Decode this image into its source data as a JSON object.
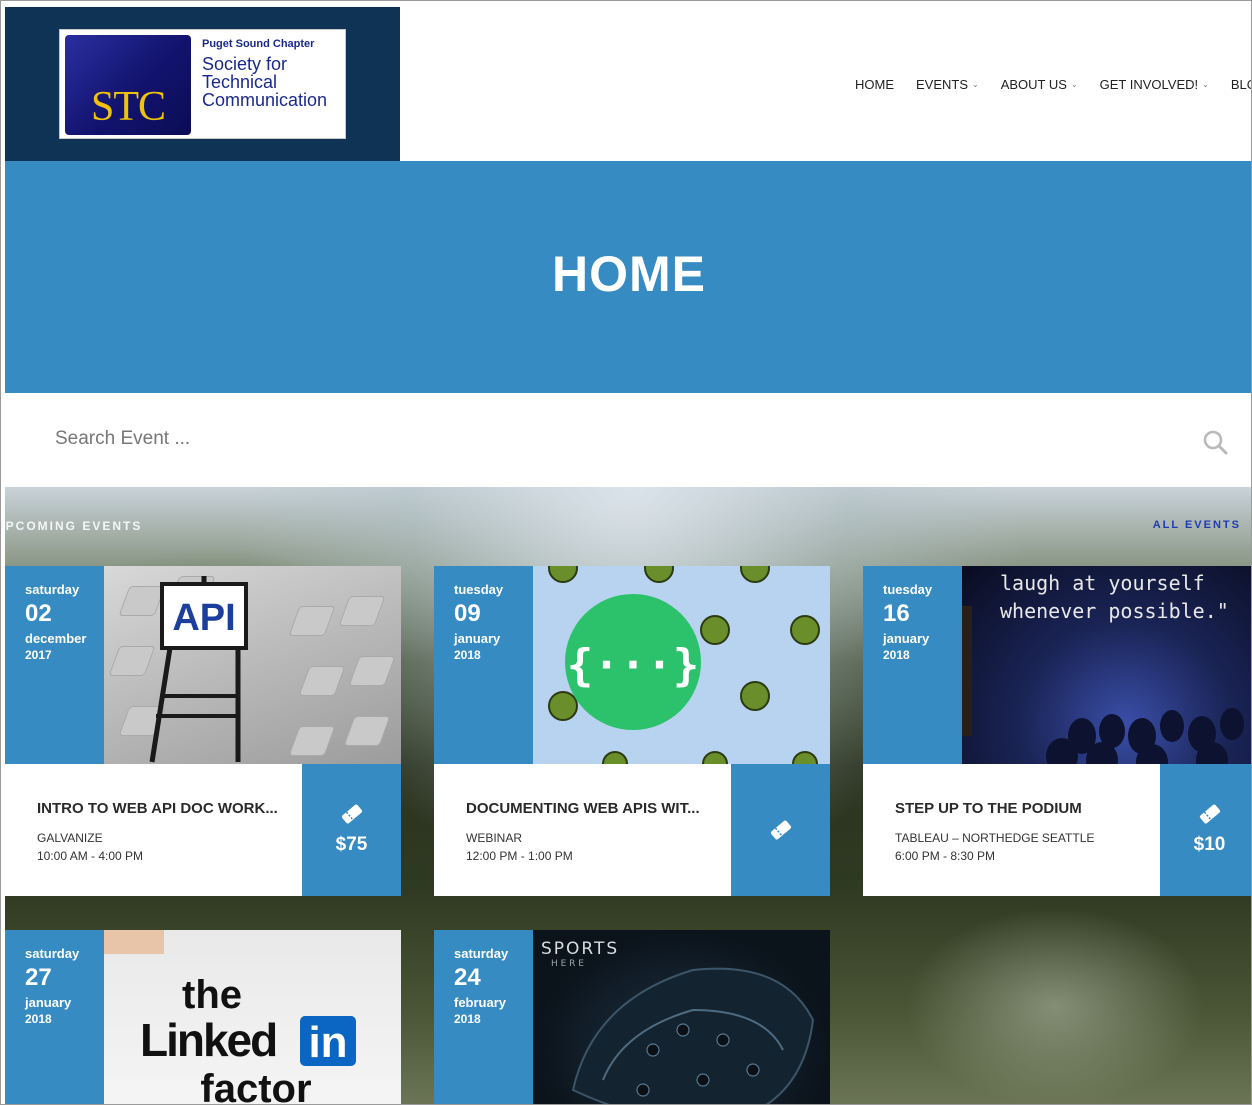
{
  "logo": {
    "chapter": "Puget Sound Chapter",
    "name": "Society for Technical Communication",
    "mark": "STC"
  },
  "nav": {
    "items": [
      {
        "label": "HOME",
        "has_caret": false
      },
      {
        "label": "EVENTS",
        "has_caret": true
      },
      {
        "label": "ABOUT US",
        "has_caret": true
      },
      {
        "label": "GET INVOLVED!",
        "has_caret": true
      },
      {
        "label": "BLO",
        "has_caret": false
      }
    ],
    "caret": "⌄"
  },
  "hero": {
    "title": "HOME"
  },
  "search": {
    "placeholder": "Search Event ..."
  },
  "section": {
    "label": "UPCOMING EVENTS",
    "all_events": "ALL EVENTS"
  },
  "colors": {
    "accent": "#368bc2",
    "header_dark": "#0e3354",
    "link": "#1e3bb4"
  },
  "events": [
    {
      "weekday": "saturday",
      "day": "02",
      "month": "december",
      "year": "2017",
      "title": "INTRO TO WEB API DOC WORK...",
      "venue": "GALVANIZE",
      "time": "10:00 AM - 4:00 PM",
      "price": "$75",
      "image": {
        "caption": "API"
      }
    },
    {
      "weekday": "tuesday",
      "day": "09",
      "month": "january",
      "year": "2018",
      "title": "DOCUMENTING WEB APIS WIT...",
      "venue": "WEBINAR",
      "time": "12:00 PM - 1:00 PM",
      "price": "",
      "image": {
        "caption": "{···}"
      }
    },
    {
      "weekday": "tuesday",
      "day": "16",
      "month": "january",
      "year": "2018",
      "title": "STEP UP TO THE PODIUM",
      "venue": "TABLEAU – NORTHEDGE SEATTLE",
      "time": "6:00 PM - 8:30 PM",
      "price": "$10",
      "image": {
        "caption_line1": "laugh at yourself",
        "caption_line2": "whenever possible.\""
      }
    },
    {
      "weekday": "saturday",
      "day": "27",
      "month": "january",
      "year": "2018",
      "image": {
        "line1": "the",
        "line2": "Linked",
        "badge": "in",
        "line3": "factor"
      }
    },
    {
      "weekday": "saturday",
      "day": "24",
      "month": "february",
      "year": "2018",
      "image": {
        "line1": "SPORTS",
        "line2": "H E R E"
      }
    }
  ]
}
